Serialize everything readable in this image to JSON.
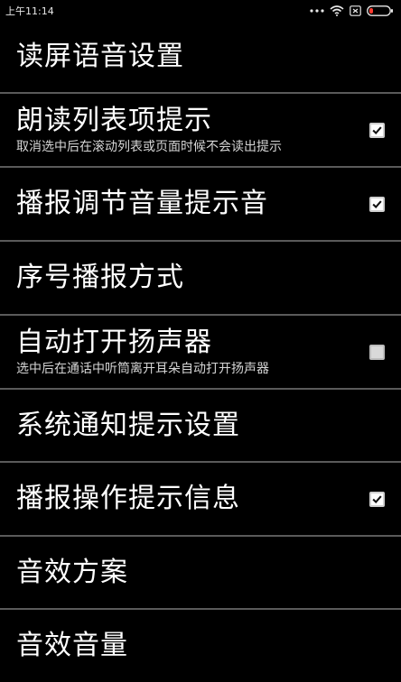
{
  "status_bar": {
    "time": "上午11:14"
  },
  "settings": {
    "screen_title": "读屏语音设置",
    "items": [
      {
        "title": "朗读列表项提示",
        "subtitle": "取消选中后在滚动列表或页面时候不会读出提示",
        "checked": true
      },
      {
        "title": "播报调节音量提示音",
        "checked": true
      },
      {
        "title": "序号播报方式"
      },
      {
        "title": "自动打开扬声器",
        "subtitle": "选中后在通话中听筒离开耳朵自动打开扬声器",
        "checked": false
      },
      {
        "title": "系统通知提示设置"
      },
      {
        "title": "播报操作提示信息",
        "checked": true
      },
      {
        "title": "音效方案"
      },
      {
        "title": "音效音量"
      }
    ]
  },
  "colors": {
    "background": "#000000",
    "divider": "#5a5a5a",
    "text": "#ffffff"
  }
}
